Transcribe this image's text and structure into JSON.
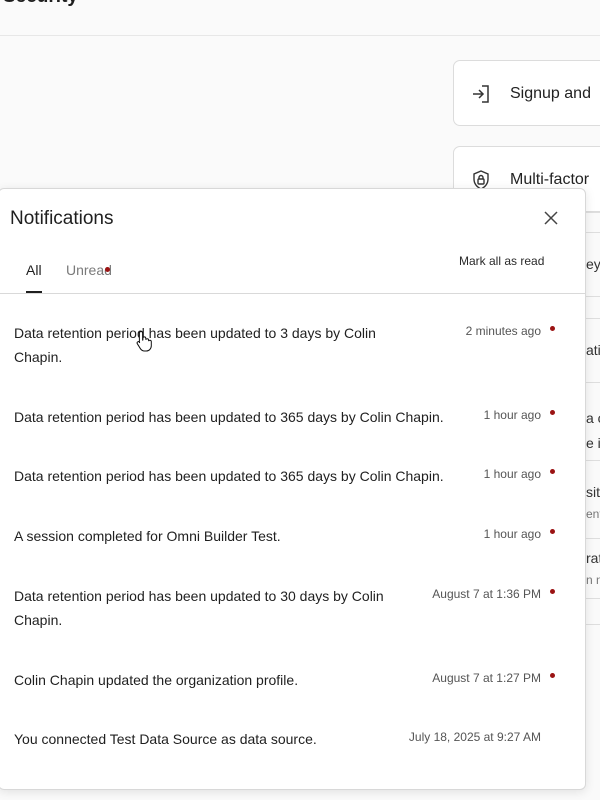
{
  "page": {
    "title": "Security"
  },
  "background_cards": [
    {
      "label": "Signup and",
      "icon": "sign-in-icon"
    },
    {
      "label": "Multi-factor",
      "icon": "shield-lock-icon"
    }
  ],
  "background_fragments": [
    "eys",
    "atio",
    "a o",
    "e i",
    "sito",
    "ents",
    "rat",
    "n n"
  ],
  "panel": {
    "title": "Notifications",
    "tabs": [
      {
        "label": "All",
        "active": true
      },
      {
        "label": "Unread",
        "active": false,
        "has_indicator": true
      }
    ],
    "mark_all_label": "Mark all as read",
    "notifications": [
      {
        "text": "Data retention period has been updated to 3 days by Colin Chapin.",
        "time": "2 minutes ago",
        "unread": true
      },
      {
        "text": "Data retention period has been updated to 365 days by Colin Chapin.",
        "time": "1 hour ago",
        "unread": true
      },
      {
        "text": "Data retention period has been updated to 365 days by Colin Chapin.",
        "time": "1 hour ago",
        "unread": true
      },
      {
        "text": "A session completed for Omni Builder Test.",
        "time": "1 hour ago",
        "unread": true
      },
      {
        "text": "Data retention period has been updated to 30 days by Colin Chapin.",
        "time": "August 7 at 1:36 PM",
        "unread": true
      },
      {
        "text": "Colin Chapin updated the organization profile.",
        "time": "August 7 at 1:27 PM",
        "unread": true
      },
      {
        "text": "You connected Test Data Source as data source.",
        "time": "July 18, 2025 at 9:27 AM",
        "unread": false
      }
    ]
  },
  "colors": {
    "unread_dot": "#9b1313",
    "panel_bg": "#ffffff",
    "page_bg": "#fafafa"
  }
}
